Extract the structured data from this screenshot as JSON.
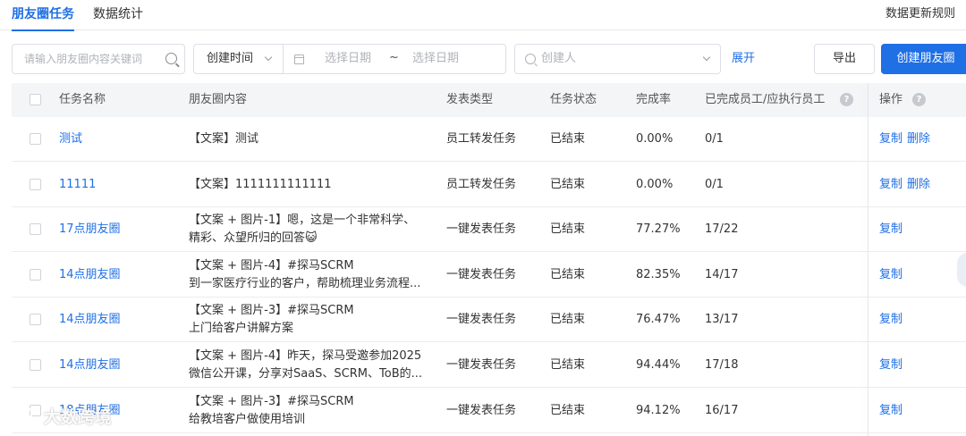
{
  "tabs": {
    "active": "朋友圈任务",
    "stats": "数据统计",
    "rules": "数据更新规则"
  },
  "filters": {
    "search_placeholder": "请输入朋友圈内容关键词",
    "date_type": "创建时间",
    "date_start": "选择日期",
    "date_sep": "~",
    "date_end": "选择日期",
    "creator_placeholder": "创建人",
    "expand": "展开",
    "export": "导出",
    "create": "创建朋友圈"
  },
  "table": {
    "columns": [
      "任务名称",
      "朋友圈内容",
      "发表类型",
      "任务状态",
      "完成率",
      "已完成员工/应执行员工",
      "操作"
    ],
    "rows": [
      {
        "name": "测试",
        "content": [
          "【文案】测试"
        ],
        "type": "员工转发任务",
        "status": "已结束",
        "rate": "0.00%",
        "count": "0/1",
        "ops": [
          "复制",
          "删除"
        ]
      },
      {
        "name": "11111",
        "content": [
          "【文案】1111111111111"
        ],
        "type": "员工转发任务",
        "status": "已结束",
        "rate": "0.00%",
        "count": "0/1",
        "ops": [
          "复制",
          "删除"
        ]
      },
      {
        "name": "17点朋友圈",
        "content": [
          "【文案 + 图片-1】嗯，这是一个非常科学、",
          "精彩、众望所归的回答😺"
        ],
        "type": "一键发表任务",
        "status": "已结束",
        "rate": "77.27%",
        "count": "17/22",
        "ops": [
          "复制"
        ]
      },
      {
        "name": "14点朋友圈",
        "content": [
          "【文案 + 图片-4】#探马SCRM",
          "到一家医疗行业的客户，帮助梳理业务流程..."
        ],
        "type": "一键发表任务",
        "status": "已结束",
        "rate": "82.35%",
        "count": "14/17",
        "ops": [
          "复制"
        ]
      },
      {
        "name": "14点朋友圈",
        "content": [
          "【文案 + 图片-3】#探马SCRM",
          "上门给客户讲解方案"
        ],
        "type": "一键发表任务",
        "status": "已结束",
        "rate": "76.47%",
        "count": "13/17",
        "ops": [
          "复制"
        ]
      },
      {
        "name": "14点朋友圈",
        "content": [
          "【文案 + 图片-4】昨天，探马受邀参加2025",
          "微信公开课，分享对SaaS、SCRM、ToB的..."
        ],
        "type": "一键发表任务",
        "status": "已结束",
        "rate": "94.44%",
        "count": "17/18",
        "ops": [
          "复制"
        ]
      },
      {
        "name": "18点朋友圈",
        "content": [
          "【文案 + 图片-3】#探马SCRM",
          "给教培客户做使用培训"
        ],
        "type": "一键发表任务",
        "status": "已结束",
        "rate": "94.12%",
        "count": "16/17",
        "ops": [
          "复制"
        ]
      }
    ]
  },
  "watermark": {
    "text": "大数跨境"
  },
  "colors": {
    "accent": "#1f6fe5",
    "header_bg": "#f4f5f7"
  }
}
